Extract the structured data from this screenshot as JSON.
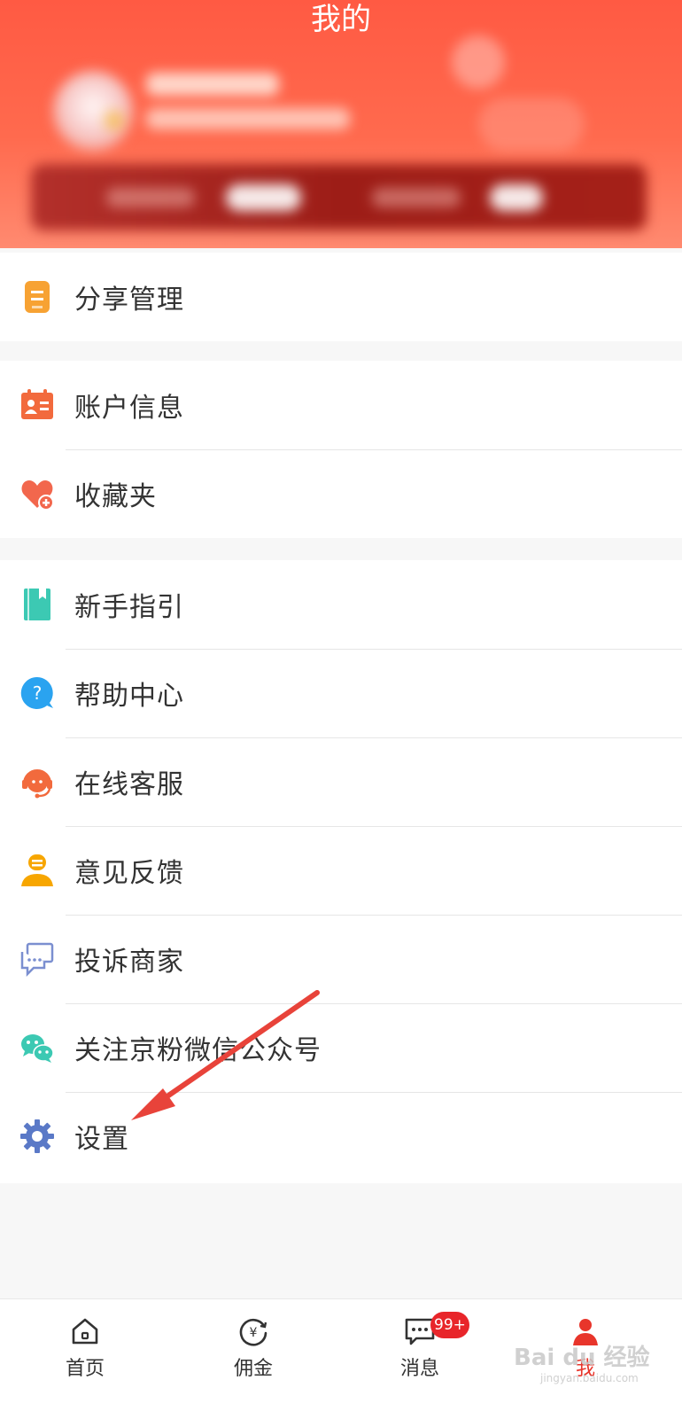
{
  "header": {
    "title": "我的"
  },
  "menu": {
    "group1": [
      {
        "label": "分享管理",
        "icon": "share-manage-icon",
        "color": "#f7a233"
      }
    ],
    "group2": [
      {
        "label": "账户信息",
        "icon": "account-card-icon",
        "color": "#f26a3d"
      },
      {
        "label": "收藏夹",
        "icon": "heart-plus-icon",
        "color": "#f2674d"
      }
    ],
    "group3": [
      {
        "label": "新手指引",
        "icon": "guide-book-icon",
        "color": "#3cc9b3"
      },
      {
        "label": "帮助中心",
        "icon": "help-question-icon",
        "color": "#2aa3f0"
      },
      {
        "label": "在线客服",
        "icon": "customer-service-icon",
        "color": "#f26a3d"
      },
      {
        "label": "意见反馈",
        "icon": "feedback-user-icon",
        "color": "#f7a600"
      },
      {
        "label": "投诉商家",
        "icon": "complaint-chat-icon",
        "color": "#7b8fd0"
      },
      {
        "label": "关注京粉微信公众号",
        "icon": "wechat-icon",
        "color": "#3cc9b3"
      },
      {
        "label": "设置",
        "icon": "gear-icon",
        "color": "#5a79c7"
      }
    ]
  },
  "nav": {
    "items": [
      {
        "label": "首页",
        "icon": "home-icon"
      },
      {
        "label": "佣金",
        "icon": "yen-coin-icon"
      },
      {
        "label": "消息",
        "icon": "message-icon",
        "badge": "99+"
      },
      {
        "label": "我",
        "icon": "person-icon",
        "active": true
      }
    ]
  },
  "watermark": {
    "text": "Bai du 经验",
    "sub": "jingyan.baidu.com"
  },
  "colors": {
    "accent": "#e8352b",
    "header_top": "#ff5a43",
    "arrow": "#e8433a"
  }
}
